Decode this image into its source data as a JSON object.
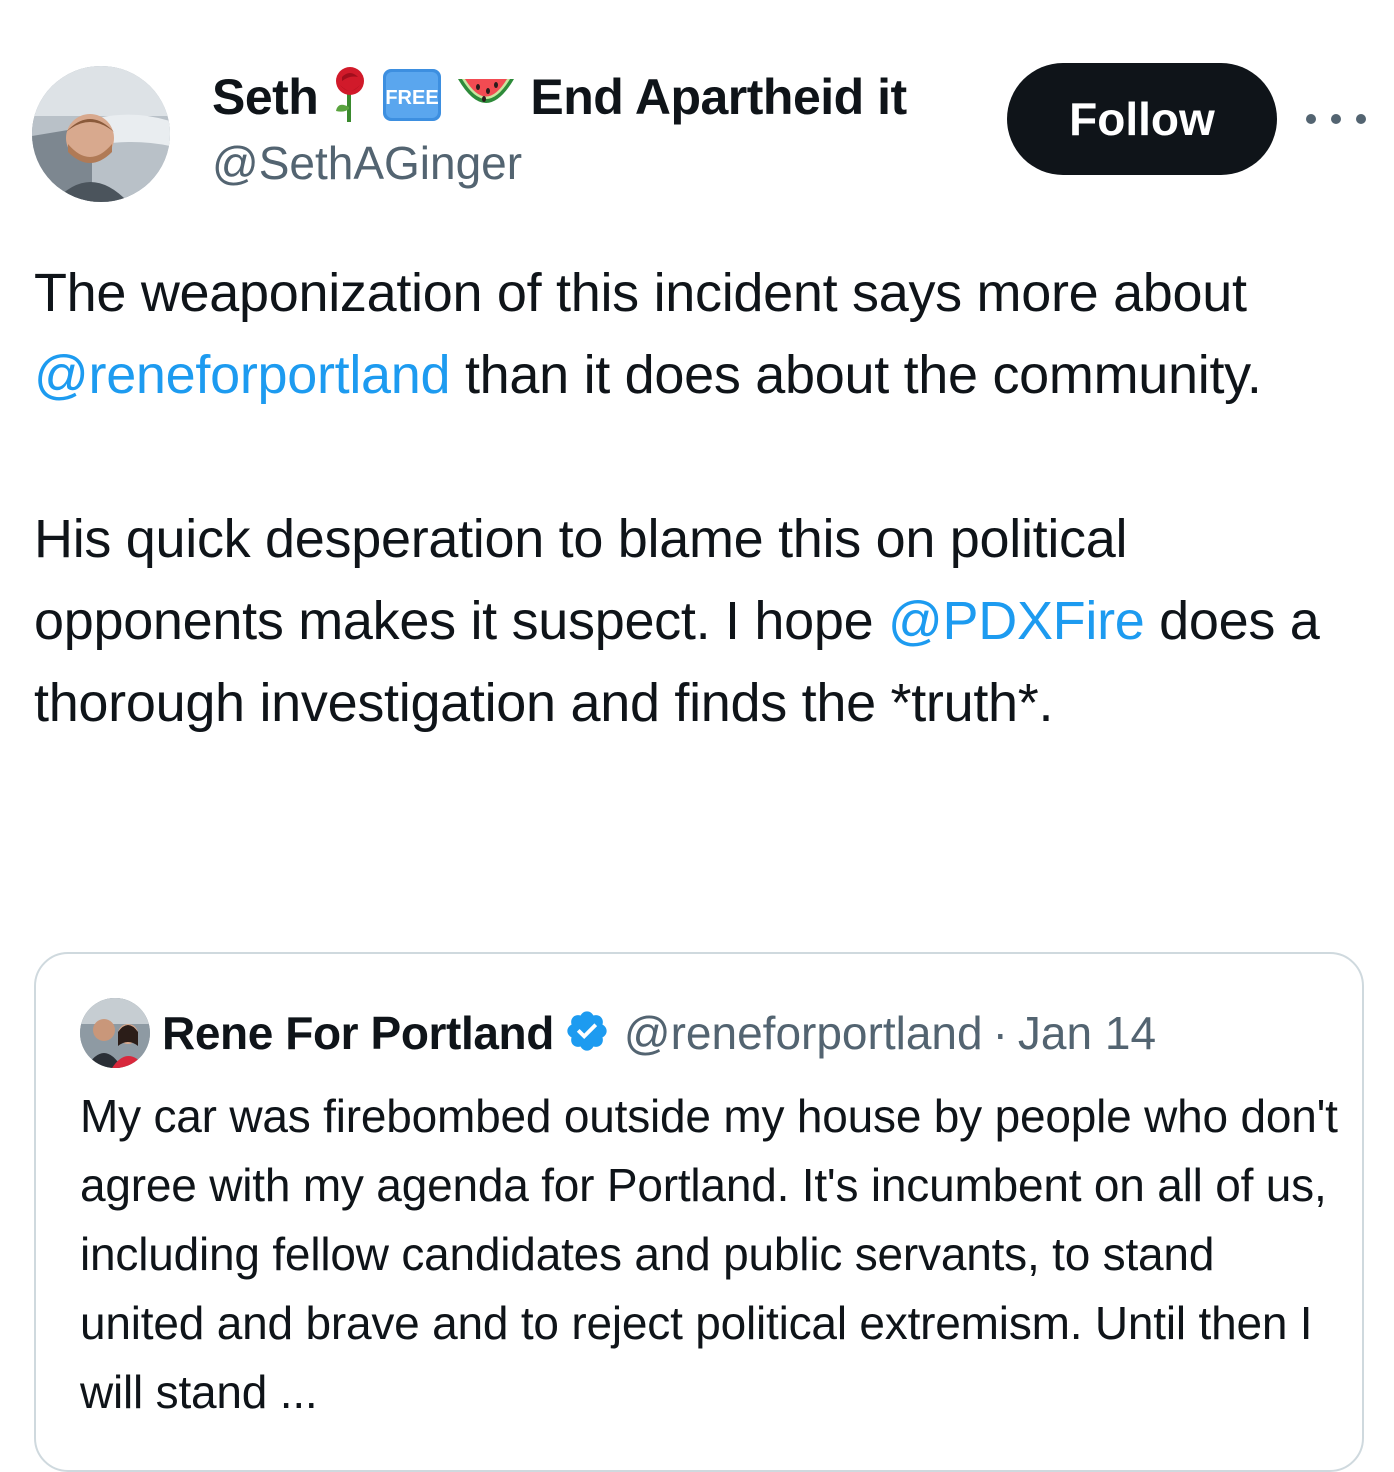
{
  "author": {
    "display_name": "Seth",
    "name_suffix": "End Apartheid it",
    "emoji_icons": [
      "rose-icon",
      "free-button-icon",
      "watermelon-icon"
    ],
    "handle": "@SethAGinger"
  },
  "follow_label": "Follow",
  "more_icon": "more-options-icon",
  "tweet": {
    "p1_before": "The weaponization of this incident says more about ",
    "p1_mention": "@reneforportland",
    "p1_after": " than it does about the community.",
    "p2_before": "His quick desperation to blame this on political opponents makes it suspect. I hope ",
    "p2_mention": "@PDXFire",
    "p2_after": " does a thorough investigation and finds the *truth*."
  },
  "quoted": {
    "name": "Rene For Portland",
    "verified_icon": "verified-badge-icon",
    "handle": "@reneforportland",
    "separator": "·",
    "date": "Jan 14",
    "text": "My car was firebombed outside my house by people who don't agree with my agenda for Portland. It's incumbent on all of us, including fellow candidates and public servants, to stand united and brave and to reject political extremism. Until then I will stand ..."
  },
  "colors": {
    "text": "#0f1419",
    "secondary": "#536471",
    "link": "#1d9bf0",
    "button_bg": "#0f1419",
    "border": "#cfd9de"
  }
}
